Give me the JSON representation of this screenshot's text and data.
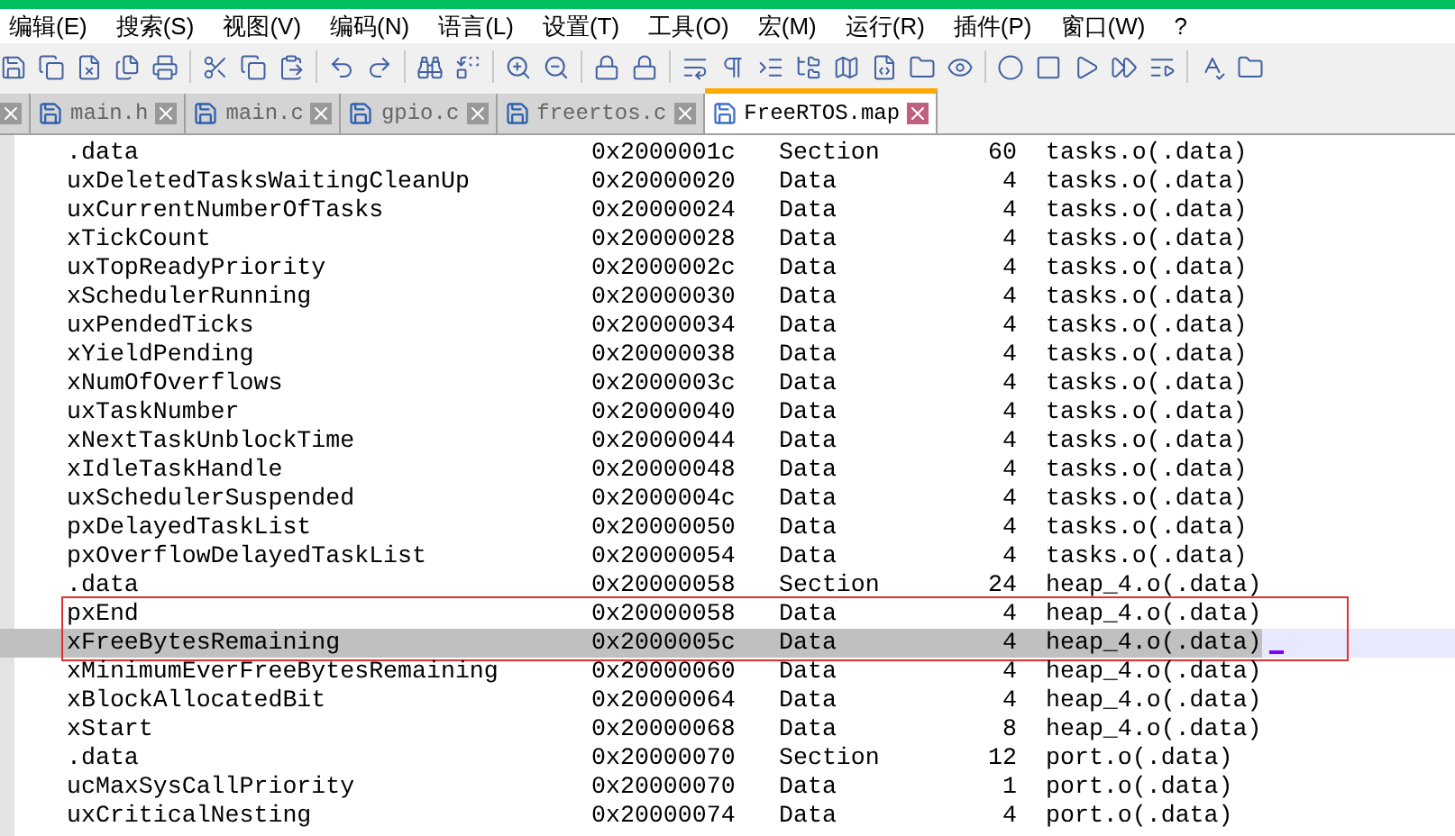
{
  "menu": [
    "编辑(E)",
    "搜索(S)",
    "视图(V)",
    "编码(N)",
    "语言(L)",
    "设置(T)",
    "工具(O)",
    "宏(M)",
    "运行(R)",
    "插件(P)",
    "窗口(W)",
    "?"
  ],
  "tabs": [
    {
      "label": "main.h",
      "selected": false
    },
    {
      "label": "main.c",
      "selected": false
    },
    {
      "label": "gpio.c",
      "selected": false
    },
    {
      "label": "freertos.c",
      "selected": false
    },
    {
      "label": "FreeRTOS.map",
      "selected": true
    }
  ],
  "rows": [
    {
      "symbol": ".data",
      "address": "0x2000001c",
      "type": "Section",
      "size": "60",
      "object": "tasks.o(.data)",
      "selected": false,
      "boxed": false
    },
    {
      "symbol": "uxDeletedTasksWaitingCleanUp",
      "address": "0x20000020",
      "type": "Data",
      "size": "4",
      "object": "tasks.o(.data)",
      "selected": false,
      "boxed": false
    },
    {
      "symbol": "uxCurrentNumberOfTasks",
      "address": "0x20000024",
      "type": "Data",
      "size": "4",
      "object": "tasks.o(.data)",
      "selected": false,
      "boxed": false
    },
    {
      "symbol": "xTickCount",
      "address": "0x20000028",
      "type": "Data",
      "size": "4",
      "object": "tasks.o(.data)",
      "selected": false,
      "boxed": false
    },
    {
      "symbol": "uxTopReadyPriority",
      "address": "0x2000002c",
      "type": "Data",
      "size": "4",
      "object": "tasks.o(.data)",
      "selected": false,
      "boxed": false
    },
    {
      "symbol": "xSchedulerRunning",
      "address": "0x20000030",
      "type": "Data",
      "size": "4",
      "object": "tasks.o(.data)",
      "selected": false,
      "boxed": false
    },
    {
      "symbol": "uxPendedTicks",
      "address": "0x20000034",
      "type": "Data",
      "size": "4",
      "object": "tasks.o(.data)",
      "selected": false,
      "boxed": false
    },
    {
      "symbol": "xYieldPending",
      "address": "0x20000038",
      "type": "Data",
      "size": "4",
      "object": "tasks.o(.data)",
      "selected": false,
      "boxed": false
    },
    {
      "symbol": "xNumOfOverflows",
      "address": "0x2000003c",
      "type": "Data",
      "size": "4",
      "object": "tasks.o(.data)",
      "selected": false,
      "boxed": false
    },
    {
      "symbol": "uxTaskNumber",
      "address": "0x20000040",
      "type": "Data",
      "size": "4",
      "object": "tasks.o(.data)",
      "selected": false,
      "boxed": false
    },
    {
      "symbol": "xNextTaskUnblockTime",
      "address": "0x20000044",
      "type": "Data",
      "size": "4",
      "object": "tasks.o(.data)",
      "selected": false,
      "boxed": false
    },
    {
      "symbol": "xIdleTaskHandle",
      "address": "0x20000048",
      "type": "Data",
      "size": "4",
      "object": "tasks.o(.data)",
      "selected": false,
      "boxed": false
    },
    {
      "symbol": "uxSchedulerSuspended",
      "address": "0x2000004c",
      "type": "Data",
      "size": "4",
      "object": "tasks.o(.data)",
      "selected": false,
      "boxed": false
    },
    {
      "symbol": "pxDelayedTaskList",
      "address": "0x20000050",
      "type": "Data",
      "size": "4",
      "object": "tasks.o(.data)",
      "selected": false,
      "boxed": false
    },
    {
      "symbol": "pxOverflowDelayedTaskList",
      "address": "0x20000054",
      "type": "Data",
      "size": "4",
      "object": "tasks.o(.data)",
      "selected": false,
      "boxed": false
    },
    {
      "symbol": ".data",
      "address": "0x20000058",
      "type": "Section",
      "size": "24",
      "object": "heap_4.o(.data)",
      "selected": false,
      "boxed": false
    },
    {
      "symbol": "pxEnd",
      "address": "0x20000058",
      "type": "Data",
      "size": "4",
      "object": "heap_4.o(.data)",
      "selected": false,
      "boxed": true
    },
    {
      "symbol": "xFreeBytesRemaining",
      "address": "0x2000005c",
      "type": "Data",
      "size": "4",
      "object": "heap_4.o(.data)",
      "selected": true,
      "boxed": true
    },
    {
      "symbol": "xMinimumEverFreeBytesRemaining",
      "address": "0x20000060",
      "type": "Data",
      "size": "4",
      "object": "heap_4.o(.data)",
      "selected": false,
      "boxed": false
    },
    {
      "symbol": "xBlockAllocatedBit",
      "address": "0x20000064",
      "type": "Data",
      "size": "4",
      "object": "heap_4.o(.data)",
      "selected": false,
      "boxed": false
    },
    {
      "symbol": "xStart",
      "address": "0x20000068",
      "type": "Data",
      "size": "8",
      "object": "heap_4.o(.data)",
      "selected": false,
      "boxed": false
    },
    {
      "symbol": ".data",
      "address": "0x20000070",
      "type": "Section",
      "size": "12",
      "object": "port.o(.data)",
      "selected": false,
      "boxed": false
    },
    {
      "symbol": "ucMaxSysCallPriority",
      "address": "0x20000070",
      "type": "Data",
      "size": "1",
      "object": "port.o(.data)",
      "selected": false,
      "boxed": false
    },
    {
      "symbol": "uxCriticalNesting",
      "address": "0x20000074",
      "type": "Data",
      "size": "4",
      "object": "port.o(.data)",
      "selected": false,
      "boxed": false
    }
  ]
}
